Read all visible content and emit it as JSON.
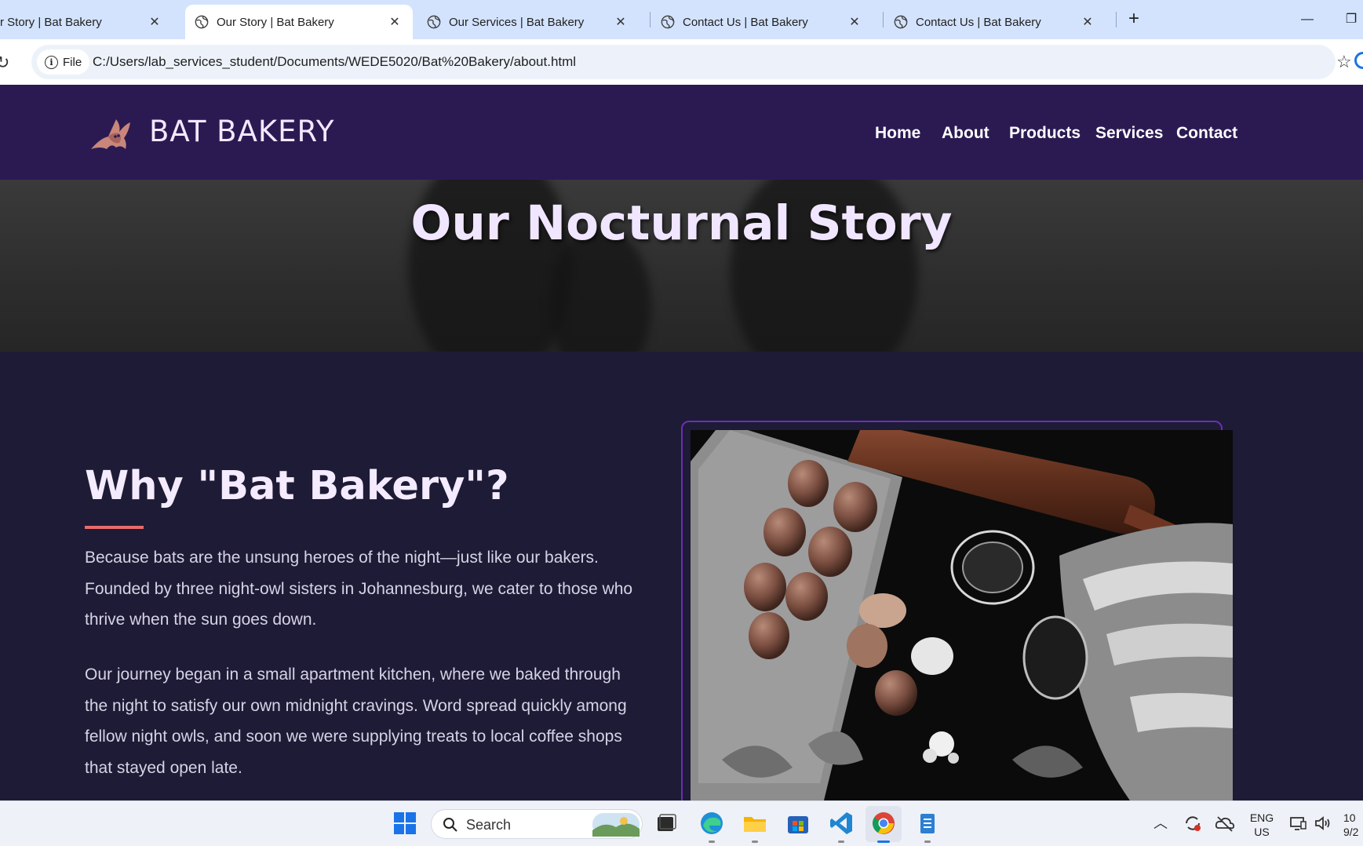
{
  "browser": {
    "tabs": [
      {
        "title": "r Story | Bat Bakery",
        "active": false
      },
      {
        "title": "Our Story | Bat Bakery",
        "active": true
      },
      {
        "title": "Our Services | Bat Bakery",
        "active": false
      },
      {
        "title": "Contact Us | Bat Bakery",
        "active": false
      },
      {
        "title": "Contact Us | Bat Bakery",
        "active": false
      }
    ],
    "new_tab_label": "+",
    "chip_label": "File",
    "url": "C:/Users/lab_services_student/Documents/WEDE5020/Bat%20Bakery/about.html"
  },
  "site": {
    "brand": "BAT BAKERY",
    "nav": [
      "Home",
      "About",
      "Products",
      "Services",
      "Contact"
    ],
    "hero_title": "Our Nocturnal Story",
    "section_heading": "Why \"Bat Bakery\"?",
    "paragraphs": [
      "Because bats are the unsung heroes of the night—just like our bakers. Founded by three night-owl sisters in Johannesburg, we cater to those who thrive when the sun goes down.",
      "Our journey began in a small apartment kitchen, where we baked through the night to satisfy our own midnight cravings. Word spread quickly among fellow night owls, and soon we were supplying treats to local coffee shops that stayed open late."
    ],
    "colors": {
      "header": "#2b1a52",
      "background": "#1e1b36",
      "accent": "#e86a6a",
      "frame": "#6b2fb3"
    }
  },
  "taskbar": {
    "search_label": "Search",
    "lang_line1": "ENG",
    "lang_line2": "US",
    "clock_line1": "10",
    "clock_line2": "9/2"
  }
}
